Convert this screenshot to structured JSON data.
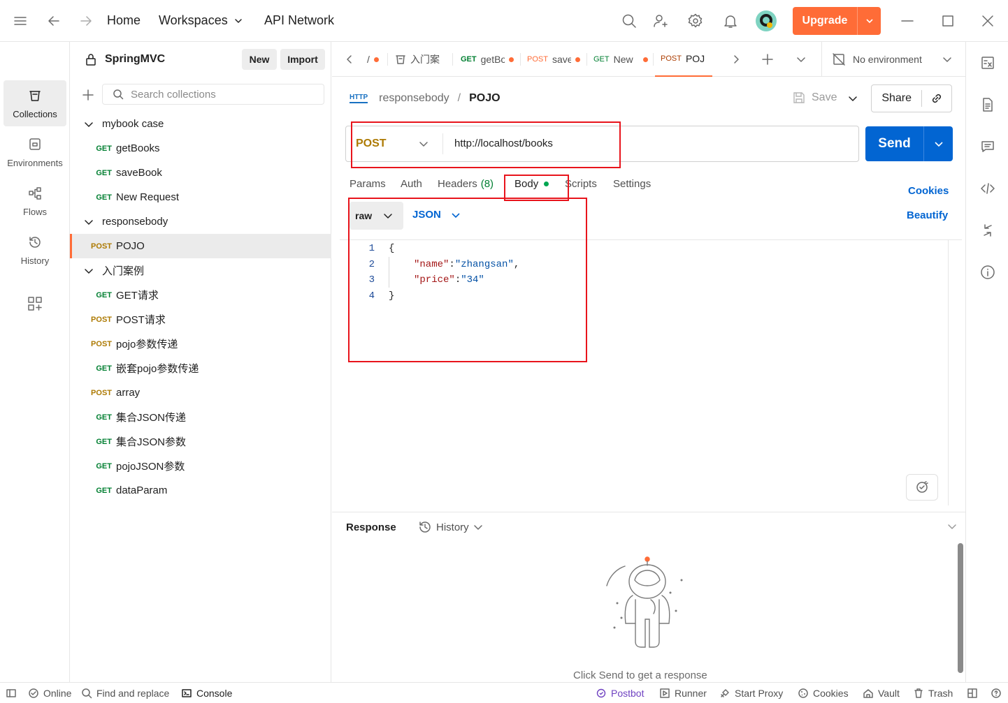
{
  "topbar": {
    "home": "Home",
    "workspaces": "Workspaces",
    "api_network": "API Network",
    "upgrade": "Upgrade"
  },
  "rail": {
    "collections": "Collections",
    "environments": "Environments",
    "flows": "Flows",
    "history": "History"
  },
  "sidebar": {
    "workspace_name": "SpringMVC",
    "new_label": "New",
    "import_label": "Import",
    "search_placeholder": "Search collections",
    "items": [
      {
        "type": "folder",
        "label": "mybook case"
      },
      {
        "type": "request",
        "method": "GET",
        "label": "getBooks"
      },
      {
        "type": "request",
        "method": "GET",
        "label": "saveBook"
      },
      {
        "type": "request",
        "method": "GET",
        "label": "New Request"
      },
      {
        "type": "folder",
        "label": "responsebody"
      },
      {
        "type": "request",
        "method": "POST",
        "label": "POJO"
      },
      {
        "type": "folder",
        "label": "入门案例"
      },
      {
        "type": "request",
        "method": "GET",
        "label": "GET请求"
      },
      {
        "type": "request",
        "method": "POST",
        "label": "POST请求"
      },
      {
        "type": "request",
        "method": "POST",
        "label": "pojo参数传递"
      },
      {
        "type": "request",
        "method": "GET",
        "label": "嵌套pojo参数传递"
      },
      {
        "type": "request",
        "method": "POST",
        "label": "array"
      },
      {
        "type": "request",
        "method": "GET",
        "label": "集合JSON传递"
      },
      {
        "type": "request",
        "method": "GET",
        "label": "集合JSON参数"
      },
      {
        "type": "request",
        "method": "GET",
        "label": "pojoJSON参数"
      },
      {
        "type": "request",
        "method": "GET",
        "label": "dataParam"
      }
    ]
  },
  "tabs": [
    {
      "method": "",
      "label": "/"
    },
    {
      "method": "",
      "label": "入门案"
    },
    {
      "method": "GET",
      "label": "getBo"
    },
    {
      "method": "POST",
      "label": "save"
    },
    {
      "method": "GET",
      "label": "New"
    },
    {
      "method": "POST",
      "label": "POJ"
    }
  ],
  "environment": "No environment",
  "request": {
    "breadcrumb_parent": "responsebody",
    "breadcrumb_sep": "/",
    "breadcrumb_current": "POJO",
    "http_badge": "HTTP",
    "save": "Save",
    "share": "Share",
    "method": "POST",
    "url": "http://localhost/books",
    "send": "Send",
    "tabs": {
      "params": "Params",
      "auth": "Auth",
      "headers": "Headers",
      "headers_count": "(8)",
      "body": "Body",
      "scripts": "Scripts",
      "settings": "Settings"
    },
    "cookies": "Cookies",
    "beautify": "Beautify",
    "body_mode": "raw",
    "body_format": "JSON",
    "line_numbers": [
      "1",
      "2",
      "3",
      "4"
    ],
    "code": {
      "open": "{",
      "k1": "\"name\"",
      "v1": "\"zhangsan\"",
      "k2": "\"price\"",
      "v2": "\"34\"",
      "close": "}"
    }
  },
  "response": {
    "title": "Response",
    "history": "History",
    "empty_text": "Click Send to get a response"
  },
  "statusbar": {
    "online": "Online",
    "find_replace": "Find and replace",
    "console": "Console",
    "postbot": "Postbot",
    "runner": "Runner",
    "start_proxy": "Start Proxy",
    "cookies": "Cookies",
    "vault": "Vault",
    "trash": "Trash"
  },
  "colors": {
    "accent": "#ff6c37",
    "send_blue": "#0265d2",
    "get_green": "#007f31",
    "post_orange": "#ad7a03",
    "highlight_red": "#e8141c"
  }
}
